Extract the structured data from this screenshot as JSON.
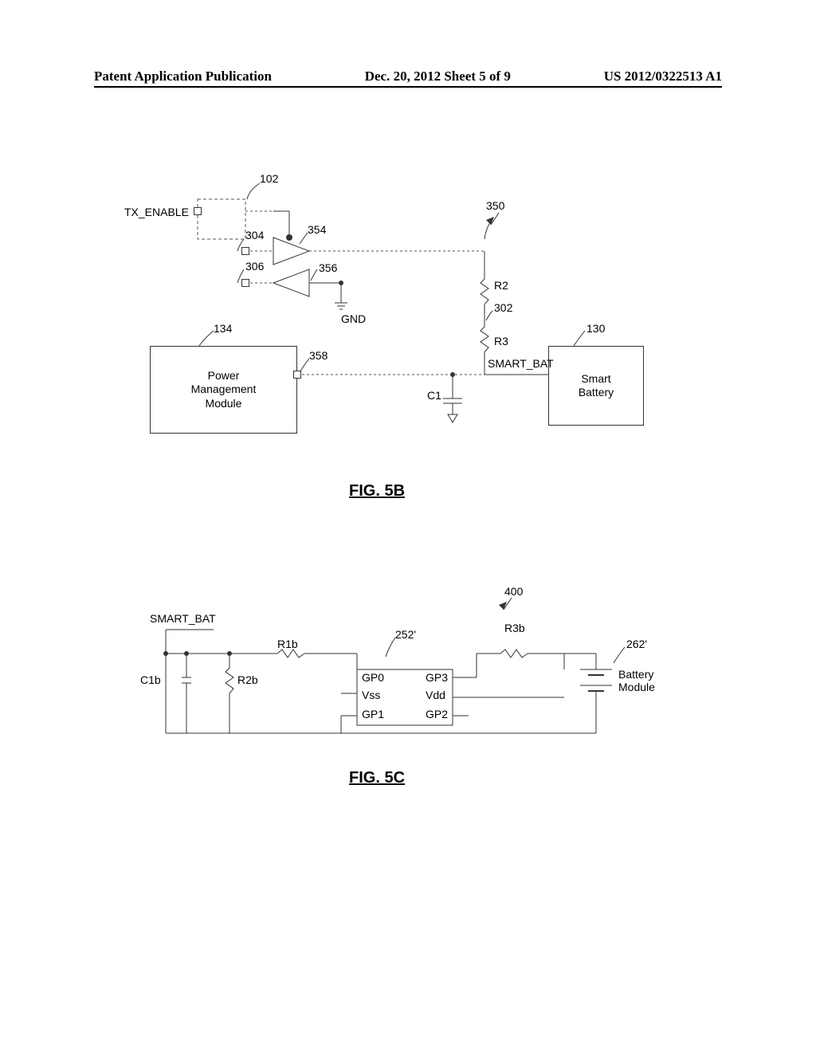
{
  "header": {
    "left": "Patent Application Publication",
    "center": "Dec. 20, 2012  Sheet 5 of 9",
    "right": "US 2012/0322513 A1"
  },
  "fig5b": {
    "caption_prefix": "FIG.  ",
    "caption_num": "5B",
    "ref_350": "350",
    "ref_102": "102",
    "ref_304": "304",
    "ref_306": "306",
    "ref_354": "354",
    "ref_356": "356",
    "ref_302": "302",
    "ref_134": "134",
    "ref_130": "130",
    "ref_358": "358",
    "tx_enable": "TX_ENABLE",
    "gnd": "GND",
    "r2": "R2",
    "r3": "R3",
    "c1": "C1",
    "smart_bat": "SMART_BAT",
    "pmm_l1": "Power",
    "pmm_l2": "Management",
    "pmm_l3": "Module",
    "smart_l1": "Smart",
    "smart_l2": "Battery"
  },
  "fig5c": {
    "caption_prefix": "FIG.  ",
    "caption_num": "5C",
    "ref_400": "400",
    "ref_252": "252'",
    "ref_262": "262'",
    "smart_bat": "SMART_BAT",
    "r1b": "R1b",
    "r2b": "R2b",
    "r3b": "R3b",
    "c1b": "C1b",
    "gp0": "GP0",
    "gp1": "GP1",
    "gp2": "GP2",
    "gp3": "GP3",
    "vss": "Vss",
    "vdd": "Vdd",
    "bat_l1": "Battery",
    "bat_l2": "Module"
  }
}
